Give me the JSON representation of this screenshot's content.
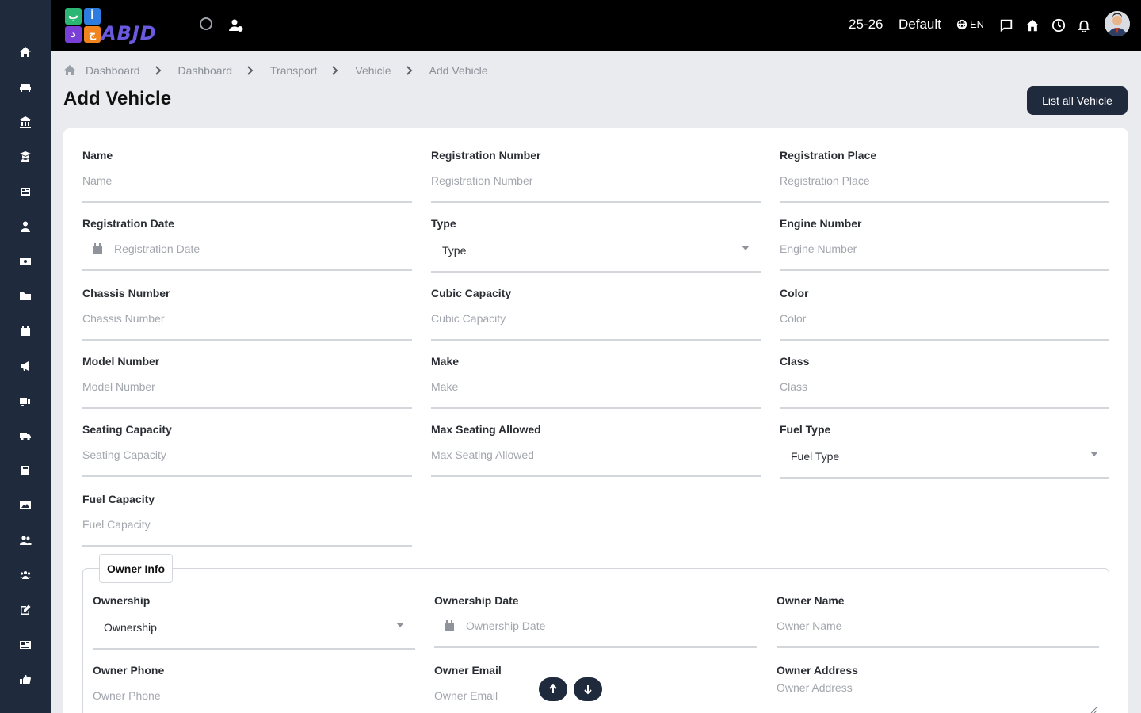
{
  "sidebar": {
    "icons": [
      "home-icon",
      "sofa-icon",
      "bank-icon",
      "graduate-icon",
      "newspaper-icon",
      "user-tie-icon",
      "money-icon",
      "folder-icon",
      "calendar-icon",
      "megaphone-icon",
      "bus-stop-icon",
      "truck-icon",
      "book-icon",
      "image-icon",
      "users-icon",
      "people-group-icon",
      "edit-icon",
      "news-icon",
      "thumbs-up-icon"
    ]
  },
  "topbar": {
    "logo_text": "ABJD",
    "logo_letters": [
      "ب",
      "أ",
      "د",
      "ج"
    ],
    "session": "25-26",
    "school": "Default",
    "language": "EN"
  },
  "breadcrumb": [
    "Dashboard",
    "Dashboard",
    "Transport",
    "Vehicle",
    "Add Vehicle"
  ],
  "page": {
    "title": "Add Vehicle",
    "list_button": "List all Vehicle"
  },
  "form": {
    "name": {
      "label": "Name",
      "placeholder": "Name"
    },
    "registration_number": {
      "label": "Registration Number",
      "placeholder": "Registration Number"
    },
    "registration_place": {
      "label": "Registration Place",
      "placeholder": "Registration Place"
    },
    "registration_date": {
      "label": "Registration Date",
      "placeholder": "Registration Date"
    },
    "type": {
      "label": "Type",
      "value": "Type"
    },
    "engine_number": {
      "label": "Engine Number",
      "placeholder": "Engine Number"
    },
    "chassis_number": {
      "label": "Chassis Number",
      "placeholder": "Chassis Number"
    },
    "cubic_capacity": {
      "label": "Cubic Capacity",
      "placeholder": "Cubic Capacity"
    },
    "color": {
      "label": "Color",
      "placeholder": "Color"
    },
    "model_number": {
      "label": "Model Number",
      "placeholder": "Model Number"
    },
    "make": {
      "label": "Make",
      "placeholder": "Make"
    },
    "class": {
      "label": "Class",
      "placeholder": "Class"
    },
    "seating_capacity": {
      "label": "Seating Capacity",
      "placeholder": "Seating Capacity"
    },
    "max_seating": {
      "label": "Max Seating Allowed",
      "placeholder": "Max Seating Allowed"
    },
    "fuel_type": {
      "label": "Fuel Type",
      "value": "Fuel Type"
    },
    "fuel_capacity": {
      "label": "Fuel Capacity",
      "placeholder": "Fuel Capacity"
    }
  },
  "owner": {
    "legend": "Owner Info",
    "ownership": {
      "label": "Ownership",
      "value": "Ownership"
    },
    "ownership_date": {
      "label": "Ownership Date",
      "placeholder": "Ownership Date"
    },
    "owner_name": {
      "label": "Owner Name",
      "placeholder": "Owner Name"
    },
    "owner_phone": {
      "label": "Owner Phone",
      "placeholder": "Owner Phone"
    },
    "owner_email": {
      "label": "Owner Email",
      "placeholder": "Owner Email"
    },
    "owner_address": {
      "label": "Owner Address",
      "placeholder": "Owner Address"
    }
  }
}
